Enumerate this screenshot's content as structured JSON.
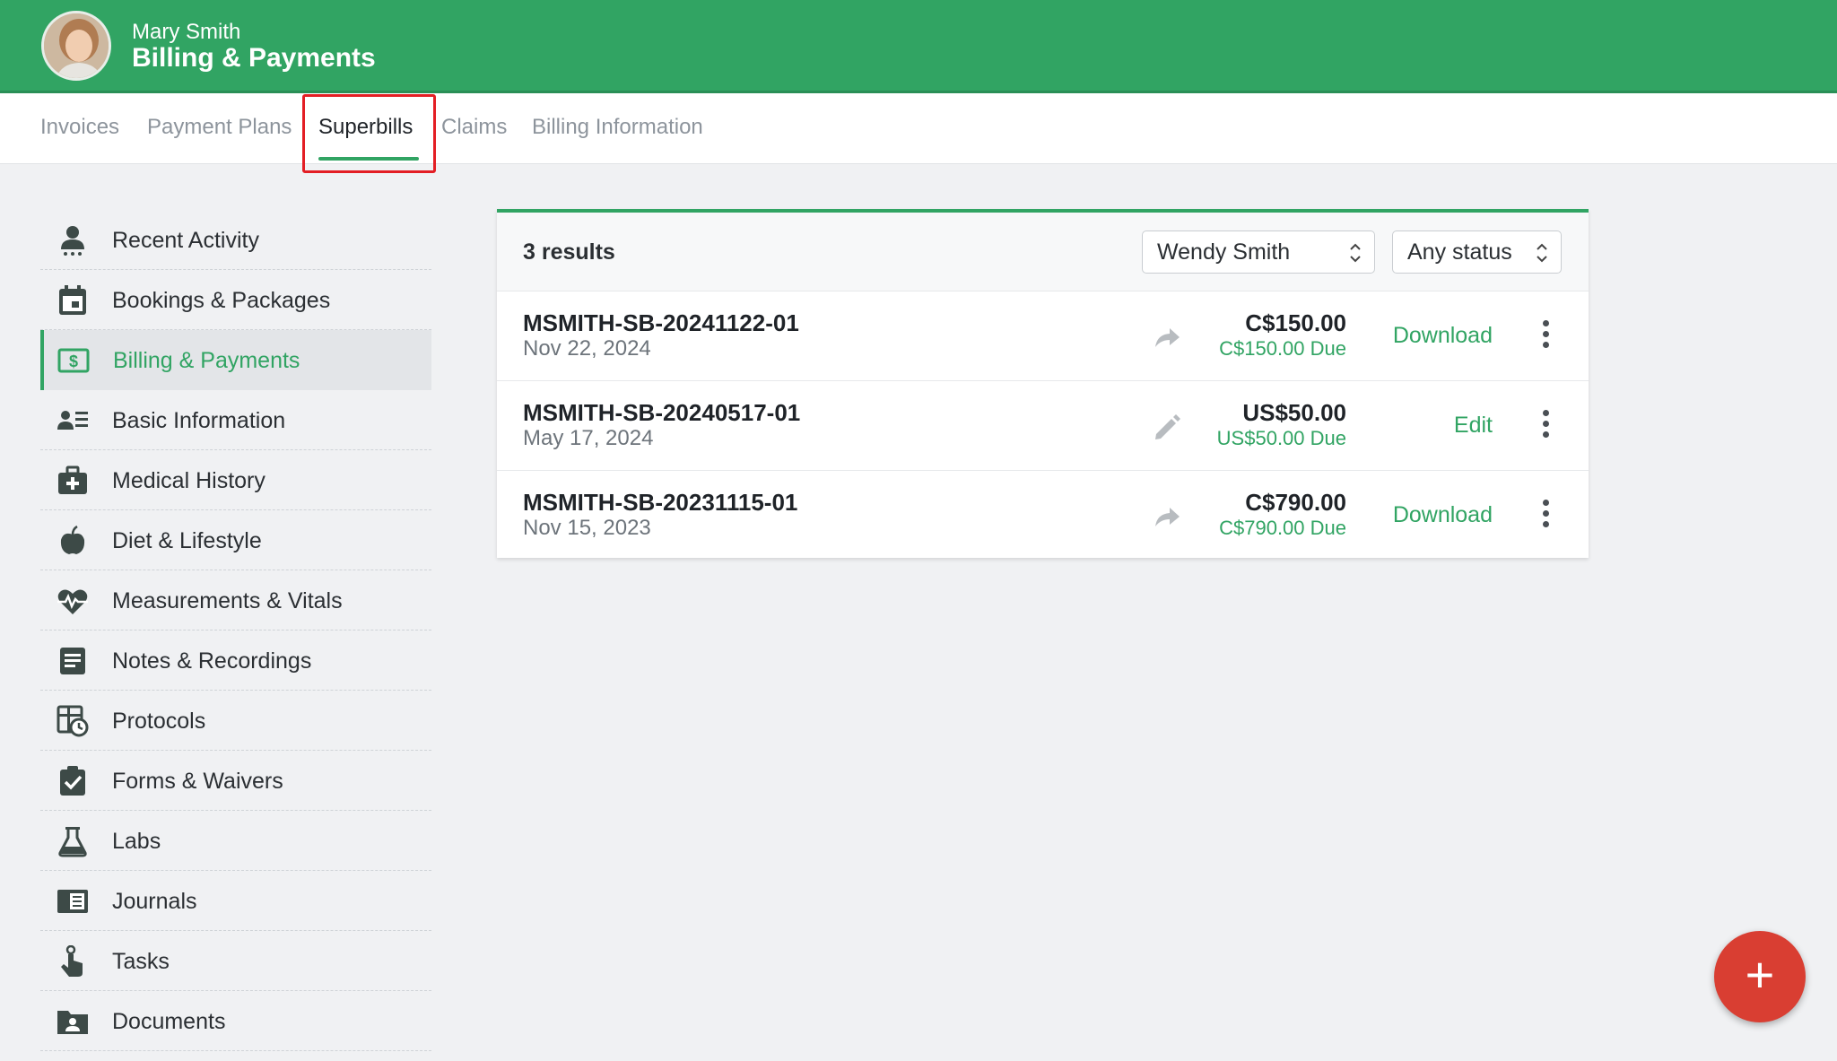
{
  "header": {
    "user_name": "Mary Smith",
    "title": "Billing & Payments"
  },
  "tabs": [
    {
      "label": "Invoices"
    },
    {
      "label": "Payment Plans"
    },
    {
      "label": "Superbills",
      "active": true
    },
    {
      "label": "Claims"
    },
    {
      "label": "Billing Information"
    }
  ],
  "sidebar": {
    "items": [
      {
        "label": "Recent Activity",
        "icon": "person-icon"
      },
      {
        "label": "Bookings & Packages",
        "icon": "calendar-icon"
      },
      {
        "label": "Billing & Payments",
        "icon": "dollar-bill-icon",
        "active": true
      },
      {
        "label": "Basic Information",
        "icon": "contact-list-icon"
      },
      {
        "label": "Medical History",
        "icon": "medical-kit-icon"
      },
      {
        "label": "Diet & Lifestyle",
        "icon": "apple-icon"
      },
      {
        "label": "Measurements & Vitals",
        "icon": "heart-pulse-icon"
      },
      {
        "label": "Notes & Recordings",
        "icon": "note-icon"
      },
      {
        "label": "Protocols",
        "icon": "protocol-clock-icon"
      },
      {
        "label": "Forms & Waivers",
        "icon": "clipboard-check-icon"
      },
      {
        "label": "Labs",
        "icon": "flask-icon"
      },
      {
        "label": "Journals",
        "icon": "journal-icon"
      },
      {
        "label": "Tasks",
        "icon": "tasks-icon"
      },
      {
        "label": "Documents",
        "icon": "folder-user-icon"
      }
    ]
  },
  "results": {
    "count_label": "3 results",
    "filter_person": "Wendy Smith",
    "filter_status": "Any status",
    "rows": [
      {
        "id": "MSMITH-SB-20241122-01",
        "date": "Nov 22, 2024",
        "amount": "C$150.00",
        "due": "C$150.00 Due",
        "action": "Download",
        "icon": "share-arrow-icon"
      },
      {
        "id": "MSMITH-SB-20240517-01",
        "date": "May 17, 2024",
        "amount": "US$50.00",
        "due": "US$50.00 Due",
        "action": "Edit",
        "icon": "pencil-icon"
      },
      {
        "id": "MSMITH-SB-20231115-01",
        "date": "Nov 15, 2023",
        "amount": "C$790.00",
        "due": "C$790.00 Due",
        "action": "Download",
        "icon": "share-arrow-icon"
      }
    ]
  },
  "fab": {
    "label": "+"
  },
  "colors": {
    "brand_green": "#31a463",
    "fab_red": "#d93e32",
    "highlight_red": "#e31e24"
  }
}
